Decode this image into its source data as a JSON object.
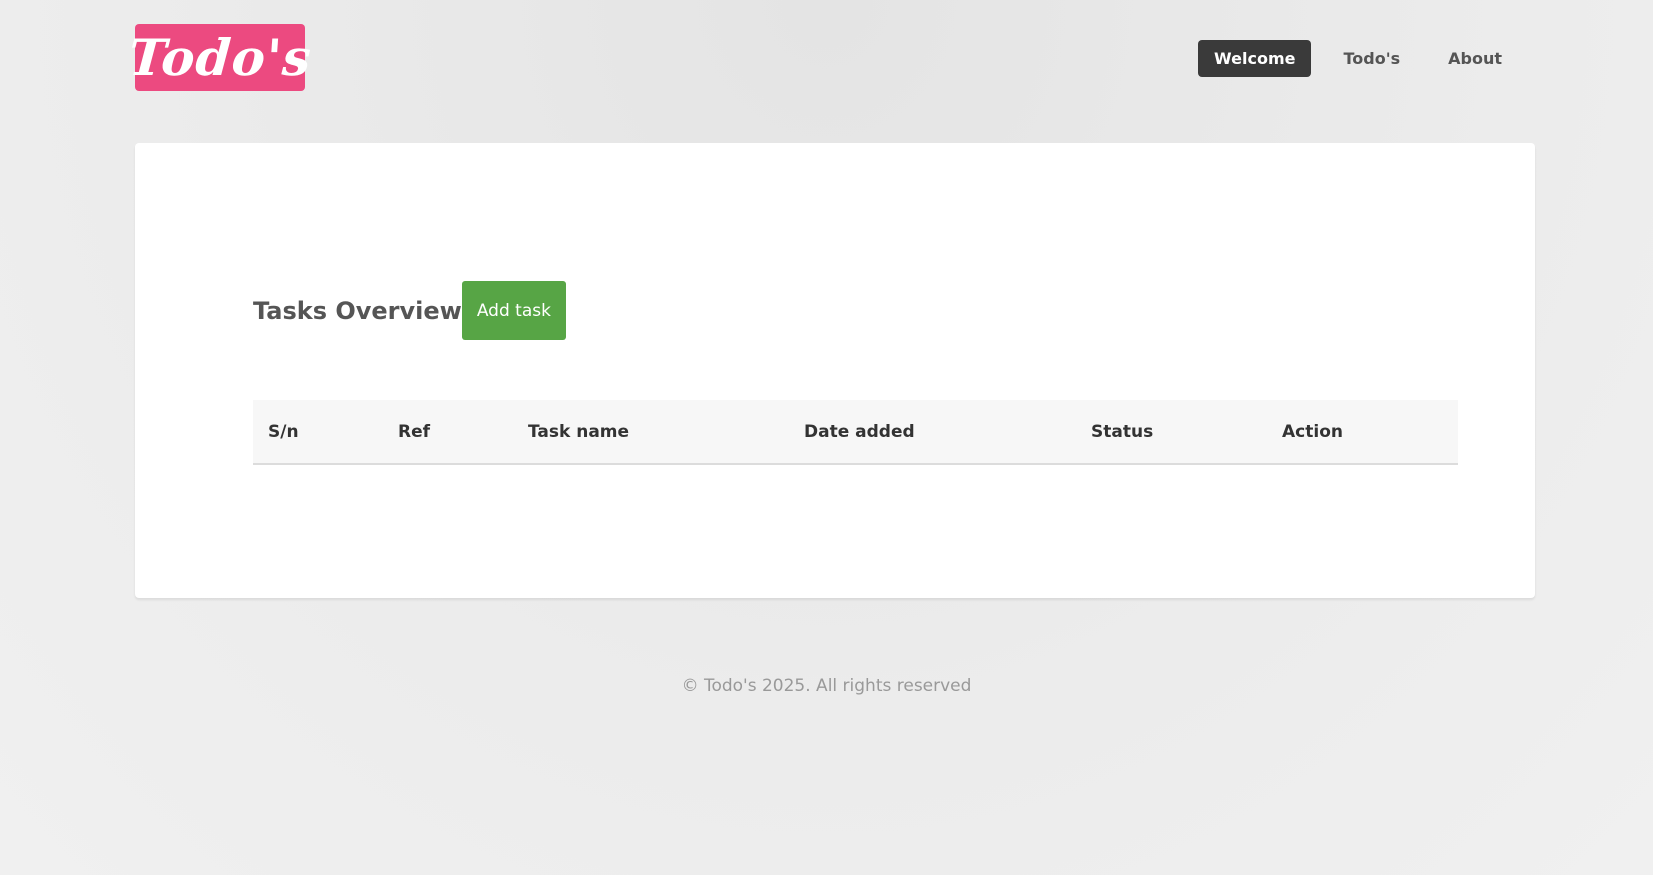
{
  "brand": {
    "logo_text": "Todo's",
    "logo_color": "#ec4a80"
  },
  "nav": {
    "items": [
      {
        "label": "Welcome",
        "active": true
      },
      {
        "label": "Todo's",
        "active": false
      },
      {
        "label": "About",
        "active": false
      }
    ]
  },
  "main": {
    "title": "Tasks Overview",
    "add_button_label": "Add task",
    "add_button_color": "#57a545",
    "table": {
      "columns": [
        "S/n",
        "Ref",
        "Task name",
        "Date added",
        "Status",
        "Action"
      ],
      "rows": []
    }
  },
  "footer": {
    "text": "© Todo's 2025. All rights reserved"
  }
}
